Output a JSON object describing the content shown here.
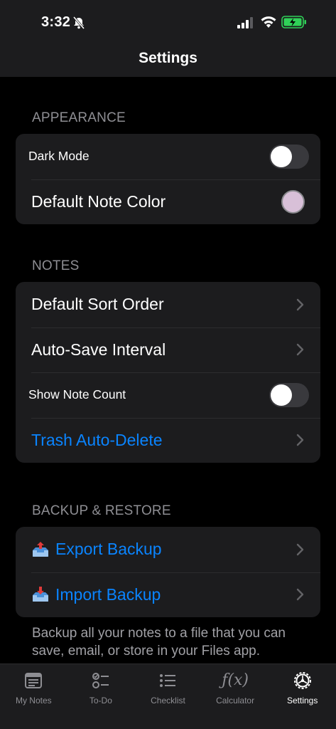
{
  "status_bar": {
    "time": "3:32"
  },
  "nav": {
    "title": "Settings"
  },
  "sections": {
    "appearance": {
      "header": "APPEARANCE",
      "dark_mode": {
        "label": "Dark Mode",
        "on": false
      },
      "default_note_color": {
        "label": "Default Note Color",
        "color": "#d8c0d8"
      }
    },
    "notes": {
      "header": "NOTES",
      "default_sort_order": "Default Sort Order",
      "auto_save_interval": "Auto-Save Interval",
      "show_note_count": {
        "label": "Show Note Count",
        "on": false
      },
      "trash_auto_delete": "Trash Auto-Delete"
    },
    "backup": {
      "header": "BACKUP & RESTORE",
      "export": "Export Backup",
      "import": "Import Backup",
      "footer": "Backup all your notes to a file that you can save, email, or store in your Files app."
    }
  },
  "tab_bar": {
    "tabs": [
      {
        "label": "My Notes",
        "icon": "notes-icon"
      },
      {
        "label": "To-Do",
        "icon": "todo-icon"
      },
      {
        "label": "Checklist",
        "icon": "checklist-icon"
      },
      {
        "label": "Calculator",
        "icon": "function-icon",
        "glyph": "ƒ(x)"
      },
      {
        "label": "Settings",
        "icon": "gear-icon",
        "active": true
      }
    ]
  },
  "colors": {
    "accent": "#0a84ff",
    "background": "#000000",
    "card": "#1c1c1e"
  }
}
